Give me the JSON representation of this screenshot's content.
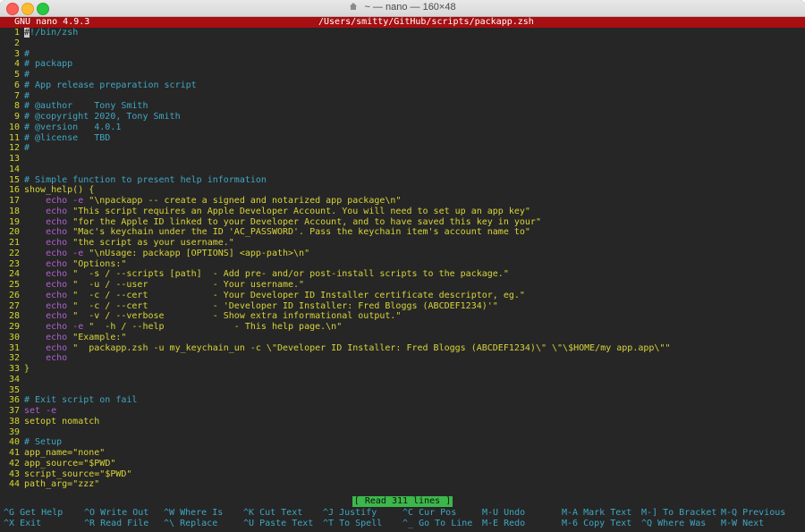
{
  "window": {
    "title": "~ — nano — 160×48"
  },
  "nano_header": {
    "version": "GNU nano 4.9.3",
    "file_path": "/Users/smitty/GitHub/scripts/packapp.zsh"
  },
  "editor": {
    "lines": [
      {
        "n": "1",
        "segs": [
          {
            "c": "cursor",
            "t": "#"
          },
          {
            "c": "c-comment",
            "t": "!/bin/zsh"
          }
        ]
      },
      {
        "n": "2",
        "segs": []
      },
      {
        "n": "3",
        "segs": [
          {
            "c": "c-comment",
            "t": "#"
          }
        ]
      },
      {
        "n": "4",
        "segs": [
          {
            "c": "c-comment",
            "t": "# packapp"
          }
        ]
      },
      {
        "n": "5",
        "segs": [
          {
            "c": "c-comment",
            "t": "#"
          }
        ]
      },
      {
        "n": "6",
        "segs": [
          {
            "c": "c-comment",
            "t": "# App release preparation script"
          }
        ]
      },
      {
        "n": "7",
        "segs": [
          {
            "c": "c-comment",
            "t": "#"
          }
        ]
      },
      {
        "n": "8",
        "segs": [
          {
            "c": "c-comment",
            "t": "# @author    Tony Smith"
          }
        ]
      },
      {
        "n": "9",
        "segs": [
          {
            "c": "c-comment",
            "t": "# @copyright 2020, Tony Smith"
          }
        ]
      },
      {
        "n": "10",
        "segs": [
          {
            "c": "c-comment",
            "t": "# @version   4.0.1"
          }
        ]
      },
      {
        "n": "11",
        "segs": [
          {
            "c": "c-comment",
            "t": "# @license   TBD"
          }
        ]
      },
      {
        "n": "12",
        "segs": [
          {
            "c": "c-comment",
            "t": "#"
          }
        ]
      },
      {
        "n": "13",
        "segs": []
      },
      {
        "n": "14",
        "segs": []
      },
      {
        "n": "15",
        "segs": [
          {
            "c": "c-comment",
            "t": "# Simple function to present help information"
          }
        ]
      },
      {
        "n": "16",
        "segs": [
          {
            "c": "c-fn",
            "t": "show_help() {"
          }
        ]
      },
      {
        "n": "17",
        "segs": [
          {
            "c": "c-kw",
            "t": "    echo -e "
          },
          {
            "c": "c-str",
            "t": "\"\\npackapp -- create a signed and notarized app package\\n\""
          }
        ]
      },
      {
        "n": "18",
        "segs": [
          {
            "c": "c-kw",
            "t": "    echo "
          },
          {
            "c": "c-str",
            "t": "\"This script requires an Apple Developer Account. You will need to set up an app key\""
          }
        ]
      },
      {
        "n": "19",
        "segs": [
          {
            "c": "c-kw",
            "t": "    echo "
          },
          {
            "c": "c-str",
            "t": "\"for the Apple ID linked to your Developer Account, and to have saved this key in your\""
          }
        ]
      },
      {
        "n": "20",
        "segs": [
          {
            "c": "c-kw",
            "t": "    echo "
          },
          {
            "c": "c-str",
            "t": "\"Mac's keychain under the ID 'AC_PASSWORD'. Pass the keychain item's account name to\""
          }
        ]
      },
      {
        "n": "21",
        "segs": [
          {
            "c": "c-kw",
            "t": "    echo "
          },
          {
            "c": "c-str",
            "t": "\"the script as your username.\""
          }
        ]
      },
      {
        "n": "22",
        "segs": [
          {
            "c": "c-kw",
            "t": "    echo -e "
          },
          {
            "c": "c-str",
            "t": "\"\\nUsage: packapp [OPTIONS] <app-path>\\n\""
          }
        ]
      },
      {
        "n": "23",
        "segs": [
          {
            "c": "c-kw",
            "t": "    echo "
          },
          {
            "c": "c-str",
            "t": "\"Options:\""
          }
        ]
      },
      {
        "n": "24",
        "segs": [
          {
            "c": "c-kw",
            "t": "    echo "
          },
          {
            "c": "c-str",
            "t": "\"  -s / --scripts [path]  - Add pre- and/or post-install scripts to the package.\""
          }
        ]
      },
      {
        "n": "25",
        "segs": [
          {
            "c": "c-kw",
            "t": "    echo "
          },
          {
            "c": "c-str",
            "t": "\"  -u / --user            - Your username.\""
          }
        ]
      },
      {
        "n": "26",
        "segs": [
          {
            "c": "c-kw",
            "t": "    echo "
          },
          {
            "c": "c-str",
            "t": "\"  -c / --cert            - Your Developer ID Installer certificate descriptor, eg.\""
          }
        ]
      },
      {
        "n": "27",
        "segs": [
          {
            "c": "c-kw",
            "t": "    echo "
          },
          {
            "c": "c-str",
            "t": "\"  -c / --cert            - 'Developer ID Installer: Fred Bloggs (ABCDEF1234)'\""
          }
        ]
      },
      {
        "n": "28",
        "segs": [
          {
            "c": "c-kw",
            "t": "    echo "
          },
          {
            "c": "c-str",
            "t": "\"  -v / --verbose         - Show extra informational output.\""
          }
        ]
      },
      {
        "n": "29",
        "segs": [
          {
            "c": "c-kw",
            "t": "    echo -e "
          },
          {
            "c": "c-str",
            "t": "\"  -h / --help             - This help page.\\n\""
          }
        ]
      },
      {
        "n": "30",
        "segs": [
          {
            "c": "c-kw",
            "t": "    echo "
          },
          {
            "c": "c-str",
            "t": "\"Example:\""
          }
        ]
      },
      {
        "n": "31",
        "segs": [
          {
            "c": "c-kw",
            "t": "    echo "
          },
          {
            "c": "c-str",
            "t": "\"  packapp.zsh -u my_keychain_un -c \\\"Developer ID Installer: Fred Bloggs (ABCDEF1234)\\\" \\\"\\$HOME/my app.app\\\"\""
          }
        ]
      },
      {
        "n": "32",
        "segs": [
          {
            "c": "c-kw",
            "t": "    echo"
          }
        ]
      },
      {
        "n": "33",
        "segs": [
          {
            "c": "c-fn",
            "t": "}"
          }
        ]
      },
      {
        "n": "34",
        "segs": []
      },
      {
        "n": "35",
        "segs": []
      },
      {
        "n": "36",
        "segs": [
          {
            "c": "c-comment",
            "t": "# Exit script on fail"
          }
        ]
      },
      {
        "n": "37",
        "segs": [
          {
            "c": "c-kw",
            "t": "set -e"
          }
        ]
      },
      {
        "n": "38",
        "segs": [
          {
            "c": "c-plain",
            "t": "setopt nomatch"
          }
        ]
      },
      {
        "n": "39",
        "segs": []
      },
      {
        "n": "40",
        "segs": [
          {
            "c": "c-comment",
            "t": "# Setup"
          }
        ]
      },
      {
        "n": "41",
        "segs": [
          {
            "c": "c-plain",
            "t": "app_name="
          },
          {
            "c": "c-str",
            "t": "\"none\""
          }
        ]
      },
      {
        "n": "42",
        "segs": [
          {
            "c": "c-plain",
            "t": "app_source="
          },
          {
            "c": "c-str",
            "t": "\"$PWD\""
          }
        ]
      },
      {
        "n": "43",
        "segs": [
          {
            "c": "c-plain",
            "t": "script_source="
          },
          {
            "c": "c-str",
            "t": "\"$PWD\""
          }
        ]
      },
      {
        "n": "44",
        "segs": [
          {
            "c": "c-plain",
            "t": "path_arg="
          },
          {
            "c": "c-str",
            "t": "\"zzz\""
          }
        ]
      }
    ]
  },
  "status": {
    "message": "[ Read 311 lines ]"
  },
  "shortcuts": {
    "row1": [
      {
        "key": "^G",
        "label": "Get Help"
      },
      {
        "key": "^O",
        "label": "Write Out"
      },
      {
        "key": "^W",
        "label": "Where Is"
      },
      {
        "key": "^K",
        "label": "Cut Text"
      },
      {
        "key": "^J",
        "label": "Justify"
      },
      {
        "key": "^C",
        "label": "Cur Pos"
      },
      {
        "key": "M-U",
        "label": "Undo"
      },
      {
        "key": "M-A",
        "label": "Mark Text"
      },
      {
        "key": "M-]",
        "label": "To Bracket"
      },
      {
        "key": "M-Q",
        "label": "Previous"
      }
    ],
    "row2": [
      {
        "key": "^X",
        "label": "Exit"
      },
      {
        "key": "^R",
        "label": "Read File"
      },
      {
        "key": "^\\",
        "label": "Replace"
      },
      {
        "key": "^U",
        "label": "Paste Text"
      },
      {
        "key": "^T",
        "label": "To Spell"
      },
      {
        "key": "^_",
        "label": "Go To Line"
      },
      {
        "key": "M-E",
        "label": "Redo"
      },
      {
        "key": "M-6",
        "label": "Copy Text"
      },
      {
        "key": "^Q",
        "label": "Where Was"
      },
      {
        "key": "M-W",
        "label": "Next"
      }
    ]
  },
  "colors": {
    "header_bg": "#a70f12",
    "comment": "#3fa7c2",
    "keyword": "#b05fd0",
    "string": "#d8d43a",
    "status_bg": "#3cb84a"
  }
}
